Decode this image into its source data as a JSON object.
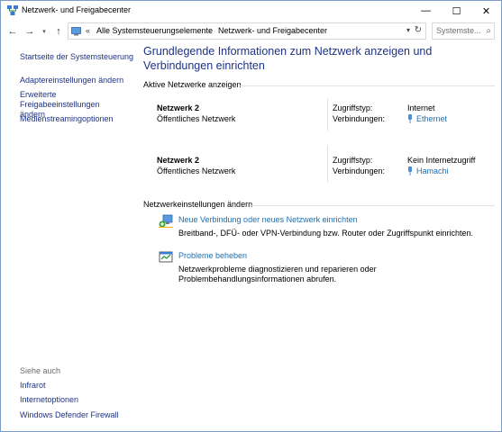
{
  "window": {
    "title": "Netzwerk- und Freigabecenter",
    "minimize": "—",
    "maximize": "☐",
    "close": "✕"
  },
  "nav": {
    "back": "←",
    "forward": "→",
    "recent": "▾",
    "up": "↑",
    "address_chevron": "«",
    "breadcrumb": [
      "Alle Systemsteuerungselemente",
      "Netzwerk- und Freigabecenter"
    ],
    "breadcrumb_sep": "›",
    "dropdown": "▾",
    "refresh": "↻",
    "search_placeholder": "Systemste...",
    "search_glyph": "⌕"
  },
  "sidebar": {
    "links": [
      "Startseite der Systemsteuerung",
      "Adaptereinstellungen ändern",
      "Erweiterte Freigabeeinstellungen ändern",
      "Medienstreamingoptionen"
    ],
    "see_also_label": "Siehe auch",
    "see_also": [
      "Infrarot",
      "Internetoptionen",
      "Windows Defender Firewall"
    ]
  },
  "main": {
    "title": "Grundlegende Informationen zum Netzwerk anzeigen und Verbindungen einrichten",
    "active_networks_heading": "Aktive Netzwerke anzeigen",
    "access_type_label": "Zugriffstyp:",
    "connections_label": "Verbindungen:",
    "networks": [
      {
        "name": "Netzwerk  2",
        "type": "Öffentliches Netzwerk",
        "access": "Internet",
        "connection": "Ethernet"
      },
      {
        "name": "Netzwerk 2",
        "type": "Öffentliches Netzwerk",
        "access": "Kein Internetzugriff",
        "connection": "Hamachi"
      }
    ],
    "change_heading": "Netzwerkeinstellungen ändern",
    "tasks": [
      {
        "link": "Neue Verbindung oder neues Netzwerk einrichten",
        "desc": "Breitband-, DFÜ- oder VPN-Verbindung bzw. Router oder Zugriffspunkt einrichten."
      },
      {
        "link": "Probleme beheben",
        "desc": "Netzwerkprobleme diagnostizieren und reparieren oder Problembehandlungsinformationen abrufen."
      }
    ]
  },
  "colors": {
    "link": "#1e6fb3",
    "nav_link": "#1e3287",
    "title_blue": "#1e3287",
    "rule": "#e2e2e2"
  }
}
